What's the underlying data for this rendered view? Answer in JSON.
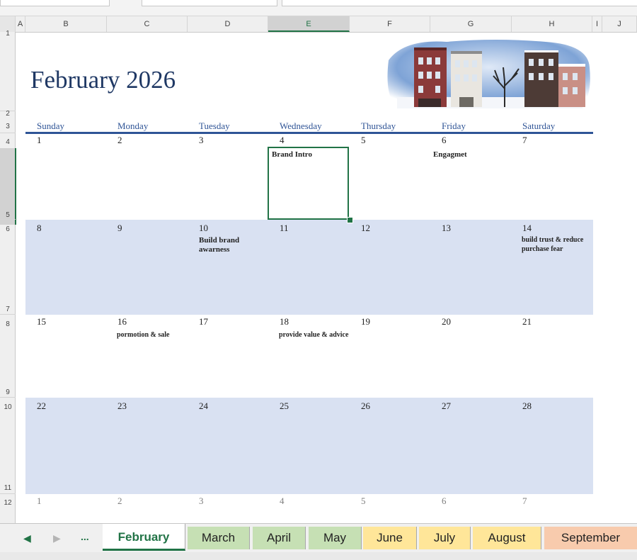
{
  "column_headers": [
    "A",
    "B",
    "C",
    "D",
    "E",
    "F",
    "G",
    "H",
    "I",
    "J"
  ],
  "row_headers": [
    "1",
    "2",
    "3",
    "4",
    "5",
    "6",
    "7",
    "8",
    "9",
    "10",
    "11",
    "12"
  ],
  "calendar": {
    "title": "February 2026",
    "weekdays": [
      "Sunday",
      "Monday",
      "Tuesday",
      "Wednesday",
      "Thursday",
      "Friday",
      "Saturday"
    ],
    "weeks": [
      [
        "1",
        "2",
        "3",
        "4",
        "5",
        "6",
        "7"
      ],
      [
        "8",
        "9",
        "10",
        "11",
        "12",
        "13",
        "14"
      ],
      [
        "15",
        "16",
        "17",
        "18",
        "19",
        "20",
        "21"
      ],
      [
        "22",
        "23",
        "24",
        "25",
        "26",
        "27",
        "28"
      ],
      [
        "1",
        "2",
        "3",
        "4",
        "5",
        "6",
        "7"
      ]
    ],
    "notes": {
      "wed4": "Brand Intro",
      "fri6": "Engagmet",
      "tue10": "Build brand awarness",
      "sat14": "build trust & reduce purchase fear",
      "mon16": "pormotion & sale",
      "wed18": "provide value & advice"
    }
  },
  "sheet_tabs": {
    "nav_more": "...",
    "tabs": [
      {
        "label": "February",
        "color": "#ffffff",
        "active": true
      },
      {
        "label": "March",
        "color": "#c6e0b4"
      },
      {
        "label": "April",
        "color": "#c6e0b4"
      },
      {
        "label": "May",
        "color": "#c6e0b4"
      },
      {
        "label": "June",
        "color": "#ffe699"
      },
      {
        "label": "July",
        "color": "#ffe699"
      },
      {
        "label": "August",
        "color": "#ffe699"
      },
      {
        "label": "September",
        "color": "#f8cbad"
      }
    ]
  },
  "colors": {
    "accent": "#217346",
    "calendar_blue": "#2f5496",
    "band": "#d9e1f2"
  }
}
